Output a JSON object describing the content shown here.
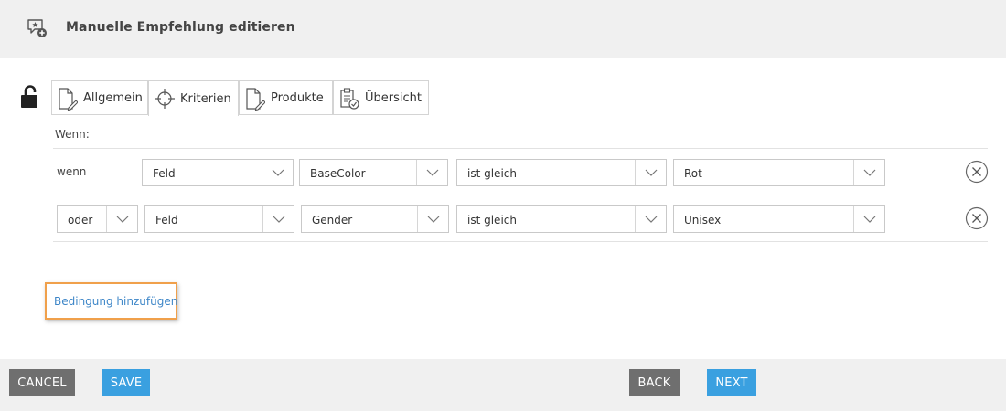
{
  "header": {
    "title": "Manuelle Empfehlung editieren"
  },
  "tabs": [
    {
      "label": "Allgemein",
      "icon": "document-edit-icon"
    },
    {
      "label": "Kriterien",
      "icon": "crosshair-icon"
    },
    {
      "label": "Produkte",
      "icon": "document-edit-icon"
    },
    {
      "label": "Übersicht",
      "icon": "clipboard-check-icon"
    }
  ],
  "criteria": {
    "wenn_label": "Wenn:",
    "rows": [
      {
        "connector": "wenn",
        "field_type": "Feld",
        "field": "BaseColor",
        "operator": "ist gleich",
        "value": "Rot"
      },
      {
        "connector": "oder",
        "field_type": "Feld",
        "field": "Gender",
        "operator": "ist gleich",
        "value": "Unisex"
      }
    ],
    "add_condition": "Bedingung hinzufügen"
  },
  "footer": {
    "cancel": "CANCEL",
    "save": "SAVE",
    "back": "BACK",
    "next": "NEXT"
  },
  "colors": {
    "link": "#3f87c8",
    "highlight": "#f0a04b",
    "button_grey": "#6f6f6f",
    "button_blue": "#3aa0e0"
  }
}
